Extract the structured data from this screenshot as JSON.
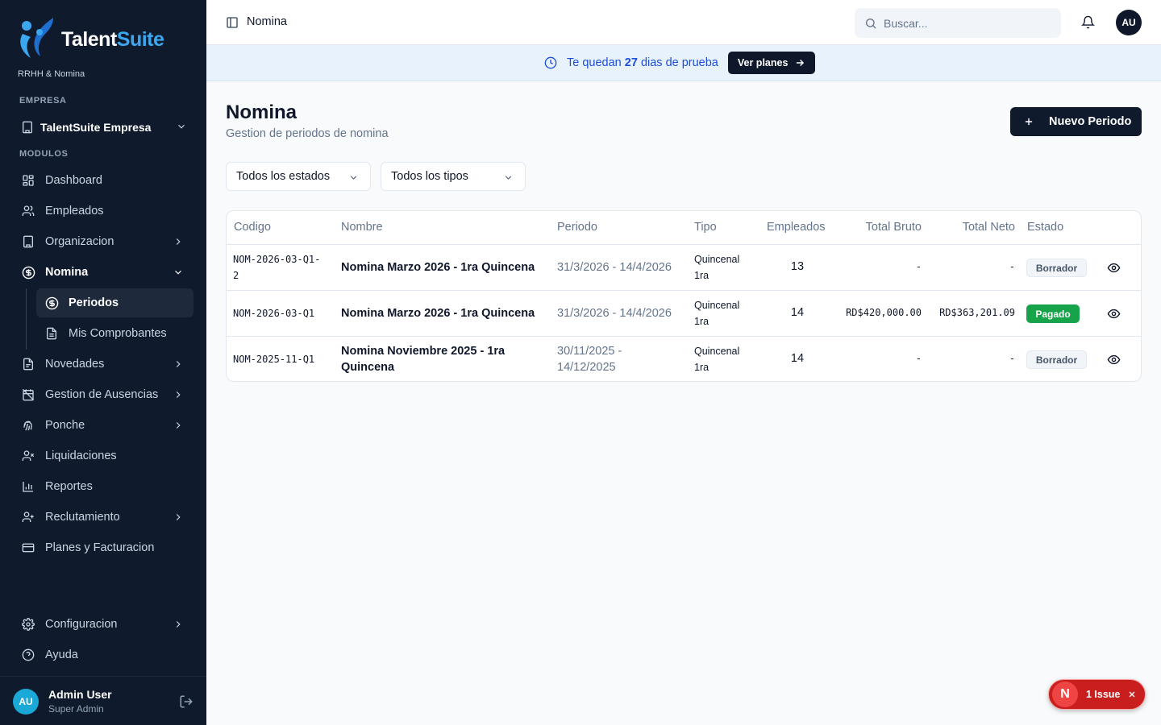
{
  "colors": {
    "sidebar_bg": "#0f1b2d",
    "brand_blue": "#3ba7f0",
    "banner_bg": "#e8f2fd",
    "paid": "#16a34a",
    "issue": "#c81e1e"
  },
  "sidebar": {
    "brand_part1": "Talent",
    "brand_part2": "Suite",
    "tagline": "RRHH & Nomina",
    "company_label": "EMPRESA",
    "company_name": "TalentSuite Empresa",
    "modules_label": "MODULOS",
    "items": [
      {
        "label": "Dashboard",
        "icon": "grid-icon"
      },
      {
        "label": "Empleados",
        "icon": "users-icon"
      },
      {
        "label": "Organizacion",
        "icon": "building-icon"
      },
      {
        "label": "Nomina",
        "icon": "dollar-circle-icon"
      },
      {
        "label": "Novedades",
        "icon": "document-icon"
      },
      {
        "label": "Gestion de Ausencias",
        "icon": "calendar-off-icon"
      },
      {
        "label": "Ponche",
        "icon": "fingerprint-icon"
      },
      {
        "label": "Liquidaciones",
        "icon": "user-x-icon"
      },
      {
        "label": "Reportes",
        "icon": "bar-chart-icon"
      },
      {
        "label": "Reclutamiento",
        "icon": "user-plus-icon"
      },
      {
        "label": "Planes y Facturacion",
        "icon": "credit-card-icon"
      },
      {
        "label": "Configuracion",
        "icon": "gear-icon"
      },
      {
        "label": "Ayuda",
        "icon": "help-circle-icon"
      }
    ],
    "subitems": [
      {
        "label": "Periodos",
        "icon": "dollar-circle-icon"
      },
      {
        "label": "Mis Comprobantes",
        "icon": "file-text-icon"
      }
    ],
    "user": {
      "initials": "AU",
      "name": "Admin User",
      "role": "Super Admin"
    }
  },
  "topbar": {
    "title": "Nomina",
    "search_placeholder": "Buscar...",
    "avatar": "AU"
  },
  "banner": {
    "prefix": "Te quedan",
    "days": "27",
    "suffix": "dias de prueba",
    "button": "Ver planes"
  },
  "page": {
    "title": "Nomina",
    "subtitle": "Gestion de periodos de nomina",
    "new_button": "Nuevo Periodo",
    "filter_status": "Todos los estados",
    "filter_type": "Todos los tipos"
  },
  "table": {
    "headers": [
      "Codigo",
      "Nombre",
      "Periodo",
      "Tipo",
      "Empleados",
      "Total Bruto",
      "Total Neto",
      "Estado"
    ],
    "rows": [
      {
        "codigo_1": "NOM-2026-03-Q1-",
        "codigo_2": "2",
        "nombre_1": "Nomina Marzo 2026 - 1ra Quincena",
        "nombre_2": "",
        "periodo_1": "31/3/2026 - 14/4/2026",
        "periodo_2": "",
        "tipo_1": "Quincenal",
        "tipo_2": "1ra",
        "empleados": "13",
        "bruto": "-",
        "neto": "-",
        "estado": "Borrador"
      },
      {
        "codigo_1": "NOM-2026-03-Q1",
        "codigo_2": "",
        "nombre_1": "Nomina Marzo 2026 - 1ra Quincena",
        "nombre_2": "",
        "periodo_1": "31/3/2026 - 14/4/2026",
        "periodo_2": "",
        "tipo_1": "Quincenal",
        "tipo_2": "1ra",
        "empleados": "14",
        "bruto": "RD$420,000.00",
        "neto": "RD$363,201.09",
        "estado": "Pagado"
      },
      {
        "codigo_1": "NOM-2025-11-Q1",
        "codigo_2": "",
        "nombre_1": "Nomina Noviembre 2025 - 1ra",
        "nombre_2": "Quincena",
        "periodo_1": "30/11/2025 -",
        "periodo_2": "14/12/2025",
        "tipo_1": "Quincenal",
        "tipo_2": "1ra",
        "empleados": "14",
        "bruto": "-",
        "neto": "-",
        "estado": "Borrador"
      }
    ]
  },
  "issue": {
    "letter": "N",
    "label": "1 Issue"
  }
}
